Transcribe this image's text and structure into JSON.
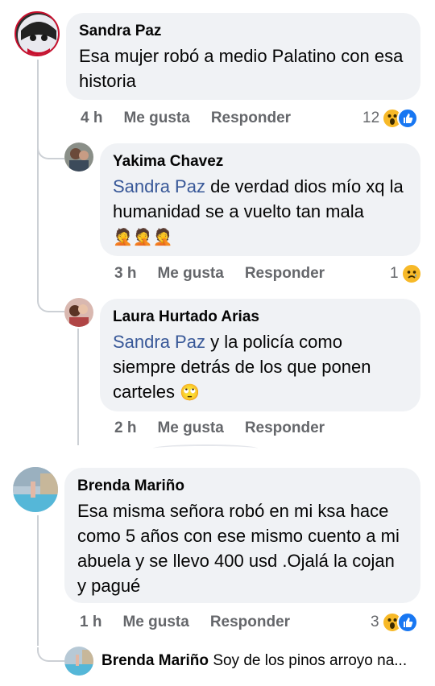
{
  "comments": [
    {
      "author": "Sandra Paz",
      "text": "Esa mujer robó a medio Palatino con esa historia",
      "time": "4 h",
      "like_label": "Me gusta",
      "reply_label": "Responder",
      "reaction_count": "12"
    },
    {
      "author": "Yakima Chavez",
      "mention": "Sandra Paz",
      "text": " de verdad dios mío xq la humanidad se a vuelto tan mala ",
      "emoji": "🤦🤦🤦",
      "time": "3 h",
      "like_label": "Me gusta",
      "reply_label": "Responder",
      "reaction_count": "1"
    },
    {
      "author": "Laura Hurtado Arias",
      "mention": "Sandra Paz",
      "text": " y la policía como siempre detrás de los que ponen carteles ",
      "emoji": "🙄",
      "time": "2 h",
      "like_label": "Me gusta",
      "reply_label": "Responder"
    },
    {
      "author": "Brenda Mariño",
      "text": "Esa misma señora robó en mi ksa hace como 5 años con ese mismo cuento a mi abuela y se llevo 400 usd .Ojalá la cojan y pagué",
      "time": "1 h",
      "like_label": "Me gusta",
      "reply_label": "Responder",
      "reaction_count": "3"
    }
  ],
  "reply_preview": {
    "author": "Brenda Mariño",
    "text": "Soy de los pinos arroyo na..."
  },
  "colors": {
    "bubble": "#f0f2f5",
    "mention": "#385898",
    "meta": "#65676b",
    "like": "#1877f2",
    "wow": "#f7b928"
  }
}
